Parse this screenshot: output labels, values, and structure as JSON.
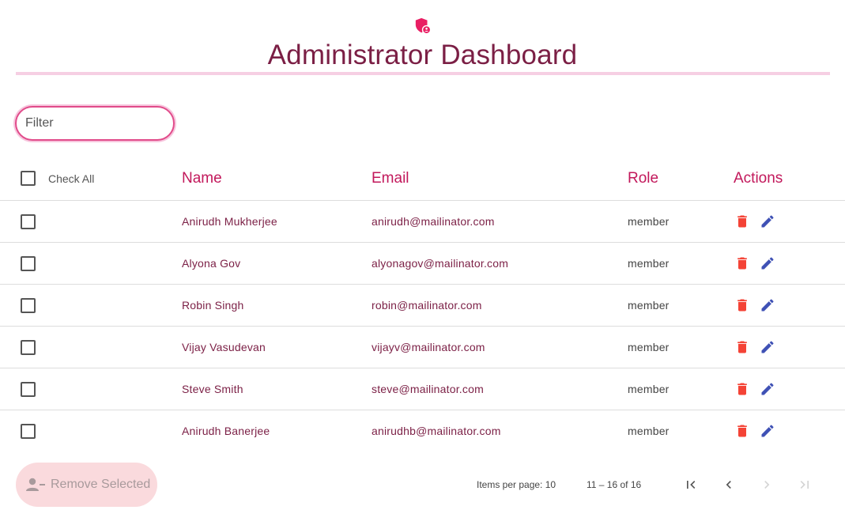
{
  "header": {
    "icon": "admin-shield-icon",
    "title": "Administrator Dashboard"
  },
  "filter": {
    "placeholder": "Filter",
    "value": ""
  },
  "table": {
    "check_all_label": "Check All",
    "columns": [
      "Name",
      "Email",
      "Role",
      "Actions"
    ],
    "rows": [
      {
        "name": "Anirudh Mukherjee",
        "email": "anirudh@mailinator.com",
        "role": "member"
      },
      {
        "name": "Alyona Gov",
        "email": "alyonagov@mailinator.com",
        "role": "member"
      },
      {
        "name": "Robin Singh",
        "email": "robin@mailinator.com",
        "role": "member"
      },
      {
        "name": "Vijay Vasudevan",
        "email": "vijayv@mailinator.com",
        "role": "member"
      },
      {
        "name": "Steve Smith",
        "email": "steve@mailinator.com",
        "role": "member"
      },
      {
        "name": "Anirudh Banerjee",
        "email": "anirudhb@mailinator.com",
        "role": "member"
      }
    ],
    "row_actions": [
      "delete-icon",
      "edit-icon"
    ]
  },
  "footer": {
    "remove_selected_label": "Remove Selected",
    "items_per_page_label": "Items per page:",
    "items_per_page_value": "10",
    "range_label": "11 – 16 of 16"
  },
  "colors": {
    "primary": "#c2185b",
    "title": "#7b1f45",
    "delete": "#f44336",
    "edit": "#3f51b5",
    "remove_button_bg": "#fadadd"
  }
}
